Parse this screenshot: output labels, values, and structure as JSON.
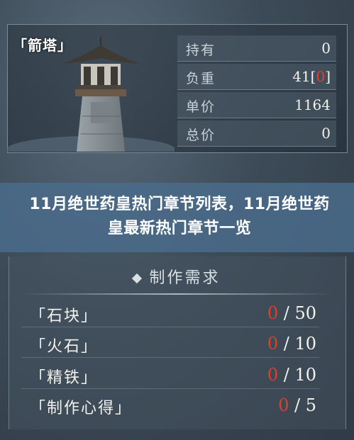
{
  "tower": {
    "name": "「箭塔」"
  },
  "stats": [
    {
      "label": "持有",
      "value": "0"
    },
    {
      "label": "负重",
      "value_main": "41",
      "value_bracket_open": "[",
      "value_red": "0",
      "value_bracket_close": "]"
    },
    {
      "label": "单价",
      "value": "1164"
    },
    {
      "label": "总价",
      "value": "0"
    }
  ],
  "banner": {
    "title": "11月绝世药皇热门章节列表，11月绝世药皇最新热门章节一览"
  },
  "requirements": {
    "title": "制作需求",
    "items": [
      {
        "name": "「石块」",
        "have": "0",
        "need": "50"
      },
      {
        "name": "「火石」",
        "have": "0",
        "need": "10"
      },
      {
        "name": "「精铁」",
        "have": "0",
        "need": "10"
      },
      {
        "name": "「制作心得」",
        "have": "0",
        "need": "5"
      }
    ]
  },
  "colors": {
    "accent_red": "#e2412f",
    "banner_blue": "#4a6c8c"
  }
}
